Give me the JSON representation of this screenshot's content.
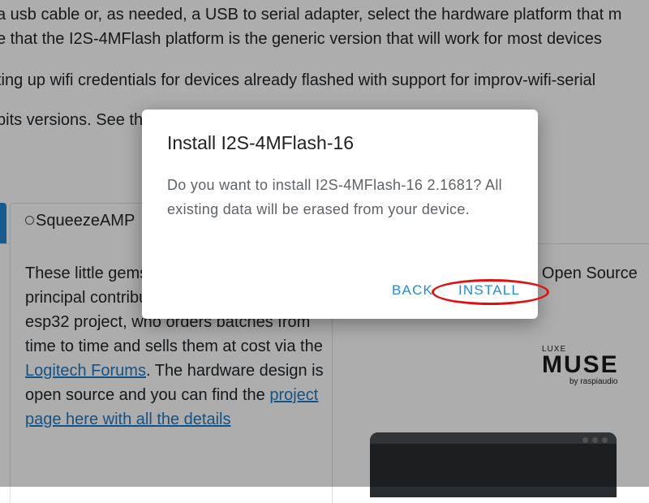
{
  "intro": {
    "line1": "a usb cable or, as needed, a USB to serial adapter, select the hardware platform that m",
    "line2": "e that the I2S-4MFlash platform is the generic version that will work for most devices",
    "line3": "ting up wifi credentials for devices already flashed with support for improv-wifi-serial",
    "line4": "bits versions. See the"
  },
  "tabs": [
    {
      "label": "SqueezeAMP"
    }
  ],
  "left_panel": {
    "desc_start": "These little gems are the result of a principal contributor to the squeezelite-esp32 project, who orders batches from time to time and sells them at cost via the ",
    "link1": "Logitech Forums",
    "desc_mid": ". The hardware design is open source and you can find the ",
    "link2": "project page here with all the details"
  },
  "right_panel": {
    "text": "Released in 2022, the first Open Source speaker and much more ."
  },
  "logo": {
    "small": "LUXE",
    "main": "MUSE",
    "sub": "by raspiaudio"
  },
  "dialog": {
    "title": "Install I2S-4MFlash-16",
    "message": "Do you want to install I2S-4MFlash-16 2.1681? All existing data will be erased from your device.",
    "back_label": "BACK",
    "install_label": "INSTALL",
    "accent_color": "#1f8ed8",
    "highlight_color": "#e01010"
  }
}
